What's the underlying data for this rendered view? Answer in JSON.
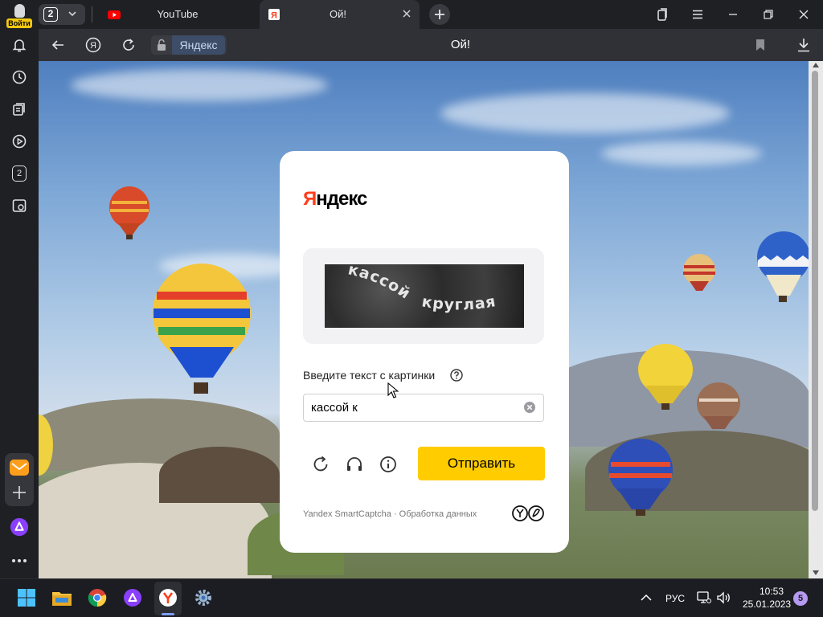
{
  "titlebar": {
    "login_label": "Войти",
    "tab_count": "2",
    "tabs": [
      {
        "label": "YouTube",
        "icon": "youtube-icon",
        "active": false
      },
      {
        "label": "Ой!",
        "icon": "yandex-favicon-icon",
        "active": true
      }
    ]
  },
  "sidebar": {
    "items": [
      "bell-icon",
      "history-icon",
      "collections-icon",
      "play-icon",
      "tabs-counter-icon",
      "screenshot-icon",
      "mail-icon",
      "add-icon",
      "alice-icon",
      "more-icon"
    ],
    "tab_counter": "2"
  },
  "addressbar": {
    "site_label": "Яндекс",
    "page_title": "Ой!"
  },
  "captcha": {
    "brand_first": "Я",
    "brand_rest": "ндекс",
    "image_text_1": "кассой",
    "image_text_2": "круглая",
    "prompt": "Введите текст с картинки",
    "answer_value": "кассой к",
    "submit_label": "Отправить",
    "footer_brand": "Yandex SmartCaptcha",
    "footer_separator": "·",
    "footer_link": "Обработка данных"
  },
  "taskbar": {
    "language": "РУС",
    "time": "10:53",
    "date": "25.01.2023",
    "notifications": "5"
  },
  "colors": {
    "yandex_red": "#fc3f1d",
    "submit_yellow": "#ffcc00",
    "chrome_dark": "#1f2024"
  }
}
